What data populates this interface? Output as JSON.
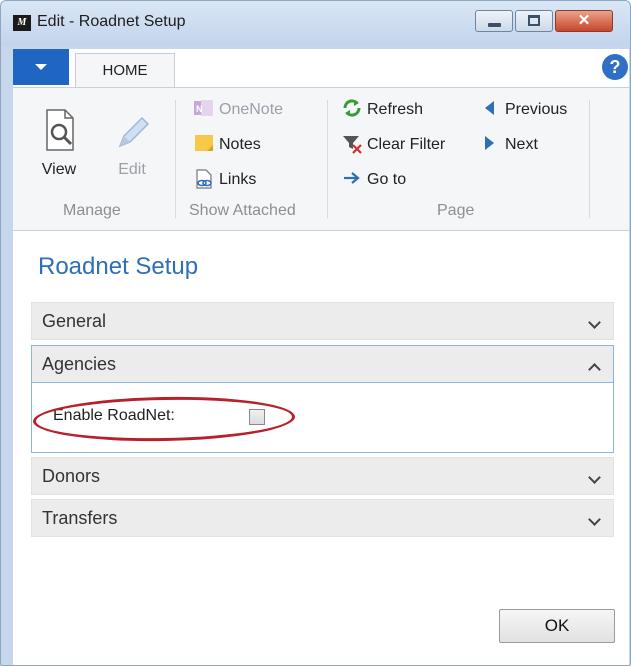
{
  "window": {
    "title": "Edit - Roadnet Setup",
    "app_icon_text": "M",
    "close_glyph": "✕"
  },
  "tabs": {
    "home": "HOME",
    "help_glyph": "?"
  },
  "ribbon": {
    "manage": {
      "view": "View",
      "edit": "Edit",
      "group_label": "Manage"
    },
    "show_attached": {
      "onenote": "OneNote",
      "notes": "Notes",
      "links": "Links",
      "group_label": "Show Attached"
    },
    "page": {
      "refresh": "Refresh",
      "clear_filter": "Clear Filter",
      "go_to": "Go to",
      "previous": "Previous",
      "next": "Next",
      "group_label": "Page"
    }
  },
  "content": {
    "page_title": "Roadnet Setup",
    "fasttabs": {
      "general": "General",
      "agencies": "Agencies",
      "donors": "Donors",
      "transfers": "Transfers"
    },
    "agencies_fields": {
      "enable_roadnet_label": "Enable RoadNet:",
      "enable_roadnet_value": false
    },
    "ok_button": "OK"
  },
  "colors": {
    "accent_blue": "#1f66c2",
    "title_blue": "#2d6fb8",
    "highlight_red": "#b7212a",
    "ribbon_bg": "#f5f6f7"
  }
}
